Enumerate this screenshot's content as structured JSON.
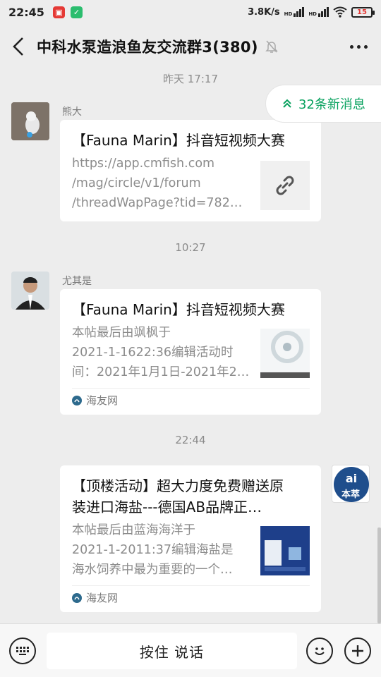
{
  "status_bar": {
    "time": "22:45",
    "net_speed": "3.8K/s",
    "sig1_label": "HD",
    "sig2_label": "HD",
    "battery": "15"
  },
  "nav": {
    "title": "中科水泵造浪鱼友交流群3(380)"
  },
  "new_messages": {
    "label": "32条新消息"
  },
  "messages": [
    {
      "timestamp": "昨天 17:17",
      "sender": "熊大",
      "card_title": "【Fauna Marin】抖音短视频大赛",
      "desc": [
        "https://app.cmfish.com",
        "/mag/circle/v1/forum",
        "/threadWapPage?tid=782…"
      ],
      "thumb_icon": "link-icon"
    },
    {
      "timestamp": "10:27",
      "sender": "尤其是",
      "card_title": "【Fauna Marin】抖音短视频大赛",
      "desc": [
        "本帖最后由飒枫于",
        "2021-1-1622:36编辑活动时",
        "间：2021年1月1日-2021年2…"
      ],
      "source": "海友网"
    },
    {
      "timestamp": "22:44",
      "card_title_lines": [
        "【顶楼活动】超大力度免费赠送原",
        "装进口海盐---德国AB品牌正…"
      ],
      "desc": [
        "本帖最后由蓝海海洋于",
        "2021-1-2011:37编辑海盐是",
        "海水饲养中最为重要的一个…"
      ],
      "source": "海友网",
      "avatar_text": "本萃"
    }
  ],
  "input_bar": {
    "talk_label": "按住 说话",
    "keyboard_icon": "keyboard-icon",
    "emoji_icon": "emoji-icon",
    "plus_icon": "plus-icon"
  },
  "colors": {
    "accent": "#07a15e",
    "background": "#ededed"
  }
}
